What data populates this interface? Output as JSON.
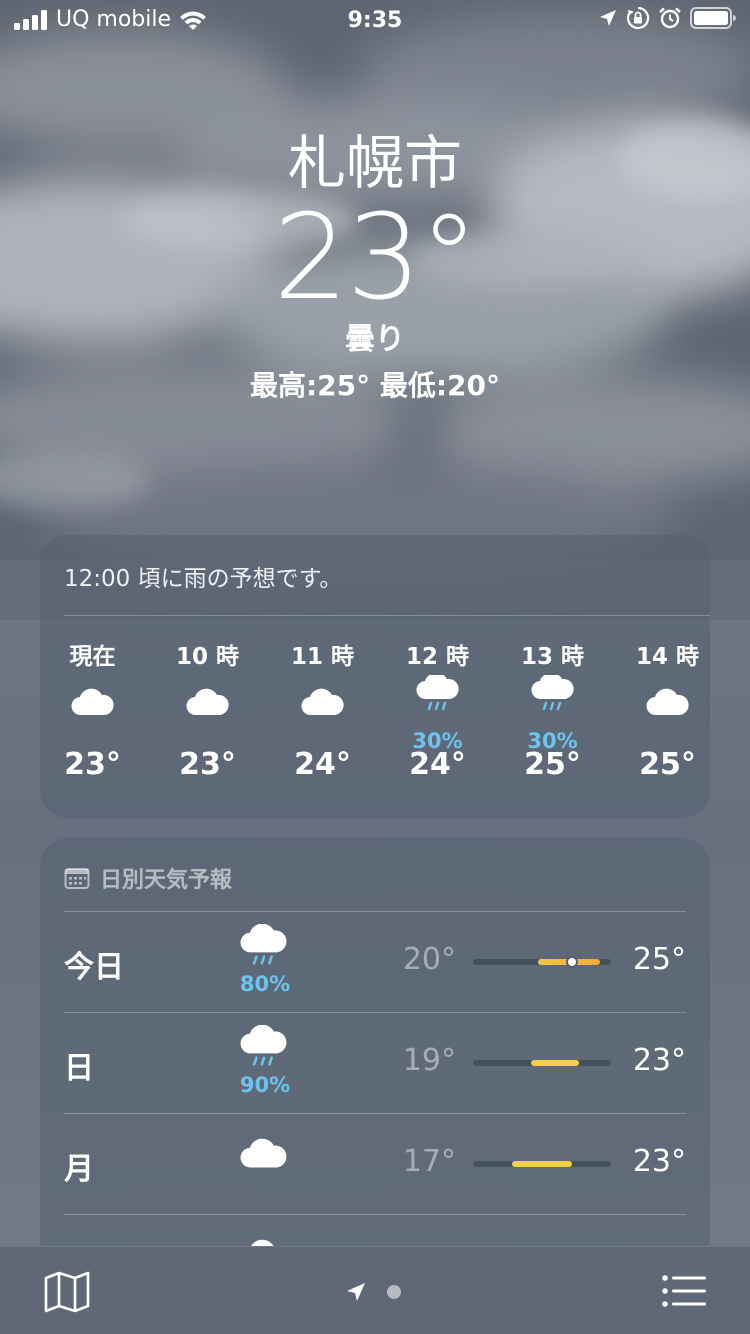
{
  "status_bar": {
    "carrier": "UQ mobile",
    "time": "9:35"
  },
  "current": {
    "city": "札幌市",
    "temperature": "23°",
    "condition": "曇り",
    "high_low": "最高:25°  最低:20°"
  },
  "hourly_card": {
    "summary": "12:00 頃に雨の予想です。",
    "hours": [
      {
        "label": "現在",
        "icon": "cloud-icon",
        "precip": "",
        "temp": "23°"
      },
      {
        "label": "10 時",
        "icon": "cloud-icon",
        "precip": "",
        "temp": "23°"
      },
      {
        "label": "11 時",
        "icon": "cloud-icon",
        "precip": "",
        "temp": "24°"
      },
      {
        "label": "12 時",
        "icon": "cloud-rain-icon",
        "precip": "30%",
        "temp": "24°"
      },
      {
        "label": "13 時",
        "icon": "cloud-rain-icon",
        "precip": "30%",
        "temp": "25°"
      },
      {
        "label": "14 時",
        "icon": "cloud-icon",
        "precip": "",
        "temp": "25°"
      }
    ]
  },
  "daily_card": {
    "header": "日別天気予報",
    "days": [
      {
        "name": "今日",
        "icon": "cloud-rain-icon",
        "precip": "80%",
        "low": "20°",
        "high": "25°",
        "range_start": 0.47,
        "range_end": 0.92,
        "current_marker": 0.72
      },
      {
        "name": "日",
        "icon": "cloud-rain-icon",
        "precip": "90%",
        "low": "19°",
        "high": "23°",
        "range_start": 0.42,
        "range_end": 0.77
      },
      {
        "name": "月",
        "icon": "cloud-icon",
        "precip": "",
        "low": "17°",
        "high": "23°",
        "range_start": 0.28,
        "range_end": 0.72
      }
    ]
  },
  "colors": {
    "precip_blue": "#6ec3ee",
    "bar_yellow": "#f2cf4a",
    "bar_orange": "#f3b33d"
  }
}
